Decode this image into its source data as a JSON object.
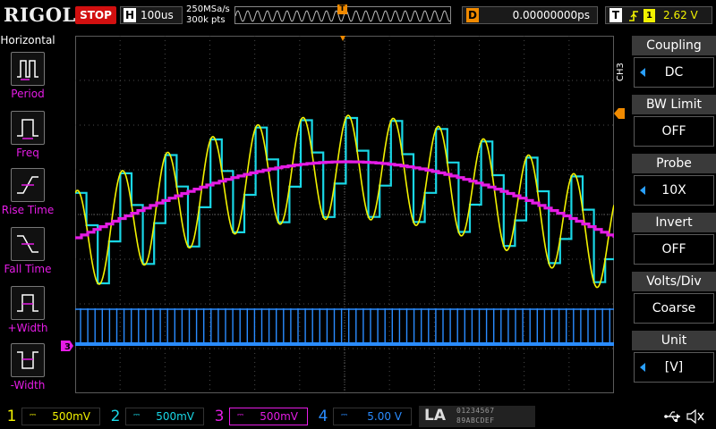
{
  "topbar": {
    "logo": "RIGOL",
    "run_state": "STOP",
    "timebase_badge": "H",
    "timebase": "100us",
    "sample_rate": "250MSa/s",
    "memory_depth": "300k pts",
    "trigger_position_marker": "T",
    "delay_badge": "D",
    "delay": "0.00000000ps",
    "trigger_badge": "T",
    "trigger_source": "1",
    "trigger_level": "2.62 V"
  },
  "left_panel": {
    "title": "Horizontal",
    "items": [
      {
        "label": "Period",
        "icon": "period-icon"
      },
      {
        "label": "Freq",
        "icon": "freq-icon"
      },
      {
        "label": "Rise Time",
        "icon": "rise-time-icon"
      },
      {
        "label": "Fall Time",
        "icon": "fall-time-icon"
      },
      {
        "label": "+Width",
        "icon": "positive-width-icon"
      },
      {
        "label": "-Width",
        "icon": "negative-width-icon"
      }
    ]
  },
  "right_panel": {
    "tab": "CH3",
    "items": [
      {
        "title": "Coupling",
        "value": "DC",
        "has_arrow": true
      },
      {
        "title": "BW Limit",
        "value": "OFF",
        "has_arrow": false
      },
      {
        "title": "Probe",
        "value": "10X",
        "has_arrow": true
      },
      {
        "title": "Invert",
        "value": "OFF",
        "has_arrow": false
      },
      {
        "title": "Volts/Div",
        "value": "Coarse",
        "has_arrow": false
      },
      {
        "title": "Unit",
        "value": "[V]",
        "has_arrow": true
      }
    ]
  },
  "channels": [
    {
      "num": "1",
      "coupling": "DC",
      "scale": "500mV",
      "color": "#f2f200"
    },
    {
      "num": "2",
      "coupling": "DC",
      "scale": "500mV",
      "color": "#19d7e6"
    },
    {
      "num": "3",
      "coupling": "DC",
      "scale": "500mV",
      "color": "#e51ce5",
      "active": true
    },
    {
      "num": "4",
      "coupling": "DC",
      "scale": "5.00 V",
      "color": "#2a8cff"
    }
  ],
  "la": {
    "label": "LA",
    "bits_row1": "01234567",
    "bits_row2": "89ABCDEF"
  },
  "grid_markers": {
    "ch3_ground": "3"
  },
  "colors": {
    "ch1": "#f2f200",
    "ch2": "#19d7e6",
    "ch3": "#e51ce5",
    "ch4": "#2a8cff",
    "trigger": "#f08a00",
    "stop": "#d21010"
  }
}
